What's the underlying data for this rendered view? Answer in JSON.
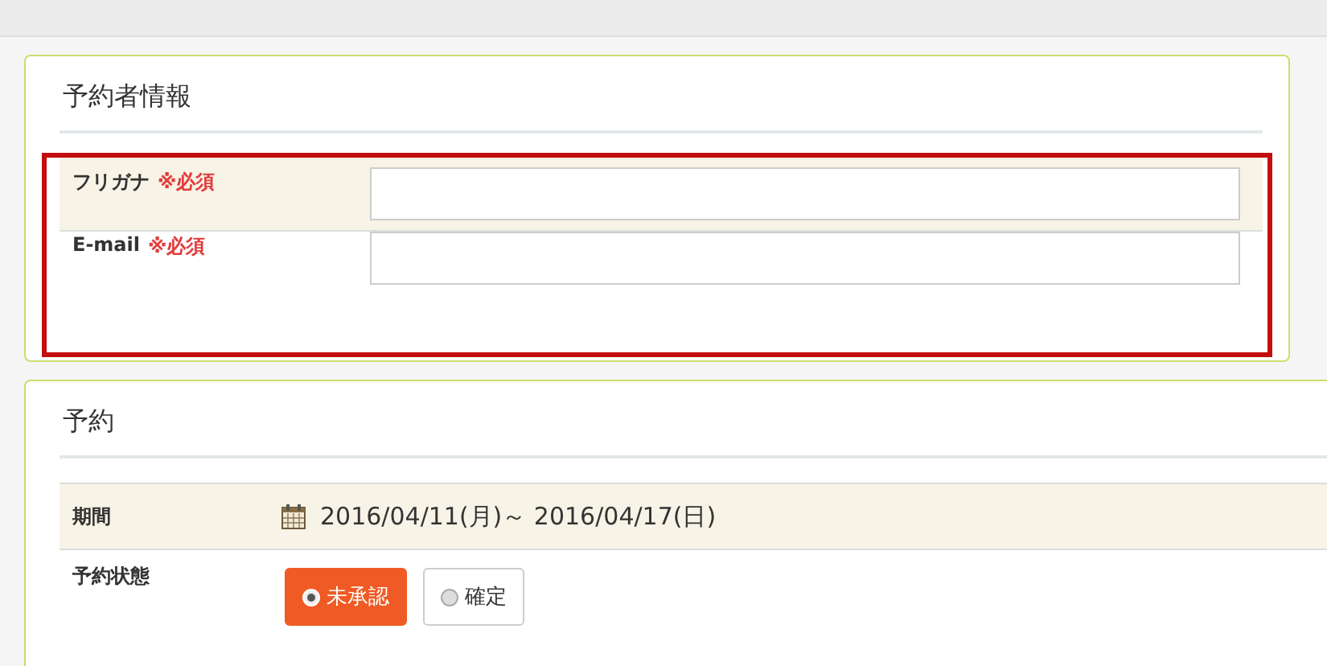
{
  "booker_section": {
    "title": "予約者情報",
    "highlighted": true,
    "fields": [
      {
        "label": "フリガナ",
        "required_mark": "※必須"
      },
      {
        "label": "E-mail",
        "required_mark": "※必須"
      }
    ]
  },
  "reservation_section": {
    "title": "予約",
    "period": {
      "label": "期間",
      "value": "2016/04/11(月)～ 2016/04/17(日)"
    },
    "status": {
      "label": "予約状態",
      "options": [
        {
          "label": "未承認",
          "selected": true
        },
        {
          "label": "確定",
          "selected": false
        }
      ]
    }
  }
}
